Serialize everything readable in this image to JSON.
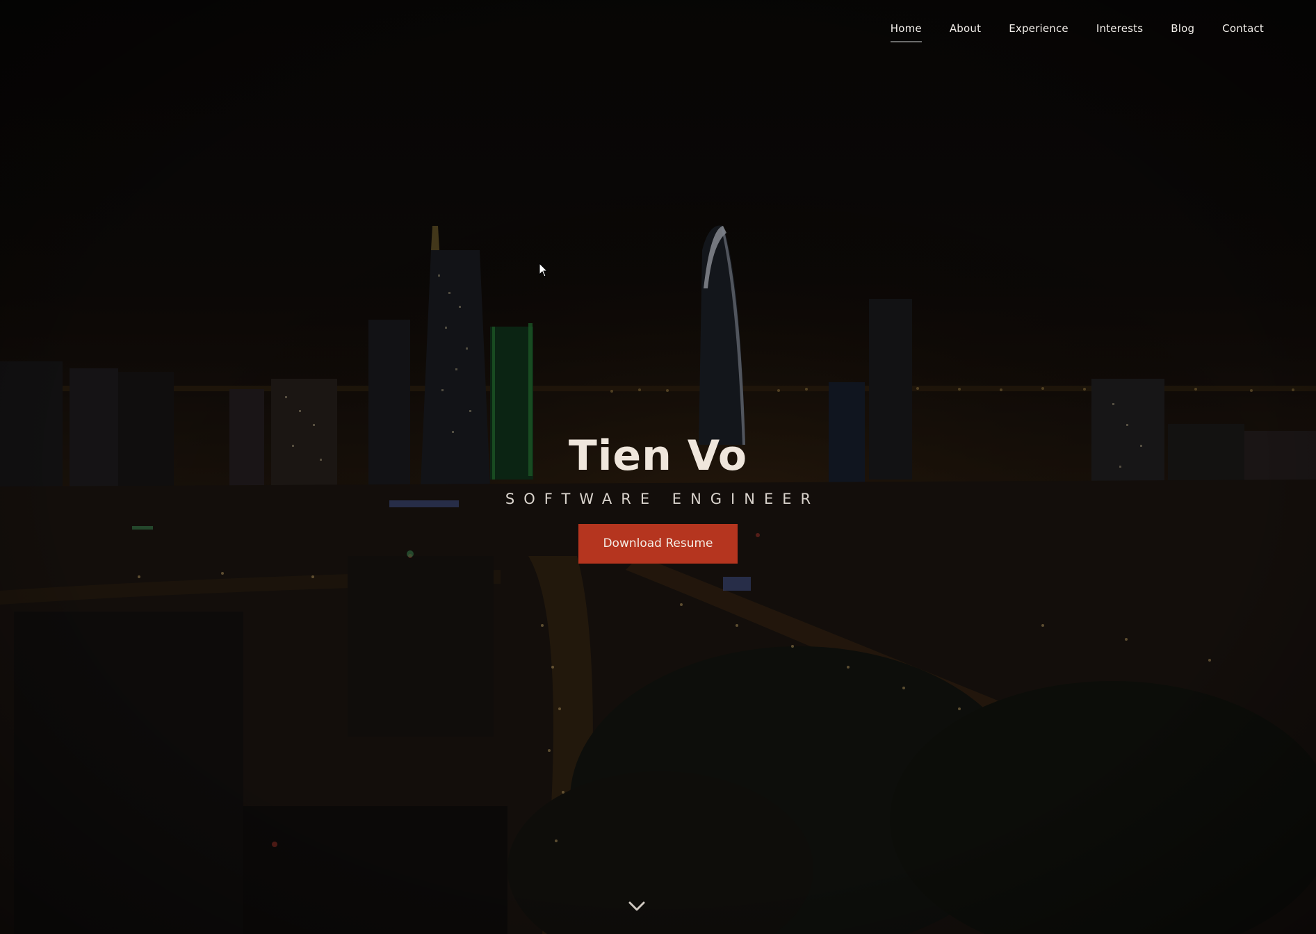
{
  "nav": {
    "items": [
      {
        "label": "Home",
        "active": true
      },
      {
        "label": "About",
        "active": false
      },
      {
        "label": "Experience",
        "active": false
      },
      {
        "label": "Interests",
        "active": false
      },
      {
        "label": "Blog",
        "active": false
      },
      {
        "label": "Contact",
        "active": false
      }
    ]
  },
  "hero": {
    "name": "Tien Vo",
    "title": "SOFTWARE ENGINEER",
    "button_label": "Download Resume",
    "background": "night-city-skyline-photo",
    "scroll_icon": "chevron-down-icon"
  },
  "colors": {
    "accent": "#b5351f",
    "text": "#efe6dc",
    "overlay": "#0b0908"
  }
}
